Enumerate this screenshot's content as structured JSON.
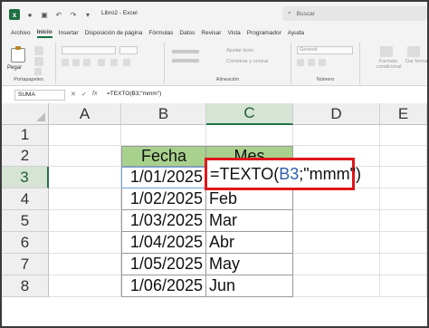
{
  "titlebar": {
    "doc_title": "Libro2 - Excel",
    "search_placeholder": "Buscar"
  },
  "menu": {
    "tabs": [
      "Archivo",
      "Inicio",
      "Insertar",
      "Disposición de página",
      "Fórmulas",
      "Datos",
      "Revisar",
      "Vista",
      "Programador",
      "Ayuda"
    ],
    "active": "Inicio"
  },
  "ribbon": {
    "paste_label": "Pegar",
    "clipboard_label": "Portapapeles",
    "alignment_label": "Alineación",
    "number_label": "Número",
    "wrap_text": "Ajustar texto",
    "merge_center": "Combinar y centrar",
    "number_format": "General",
    "conditional_format": "Formato condicional",
    "format_as_table": "Dar forma"
  },
  "formula_bar": {
    "name_box": "SUMA",
    "formula": "=TEXTO(B3;\"mmm\")"
  },
  "sheet": {
    "columns": [
      "A",
      "B",
      "C",
      "D",
      "E"
    ],
    "rows": [
      "1",
      "2",
      "3",
      "4",
      "5",
      "6",
      "7",
      "8"
    ],
    "header_fecha": "Fecha",
    "header_mes": "Mes",
    "fechas": [
      "1/01/2025",
      "1/02/2025",
      "1/03/2025",
      "1/04/2025",
      "1/05/2025",
      "1/06/2025"
    ],
    "meses": [
      "",
      "Feb",
      "Mar",
      "Abr",
      "May",
      "Jun"
    ],
    "editing": {
      "prefix": "=TEXTO(",
      "ref": "B3",
      "suffix": ";\"mmm\")"
    },
    "header_fill": "#a9d18e",
    "highlight_color": "#e0161b"
  }
}
